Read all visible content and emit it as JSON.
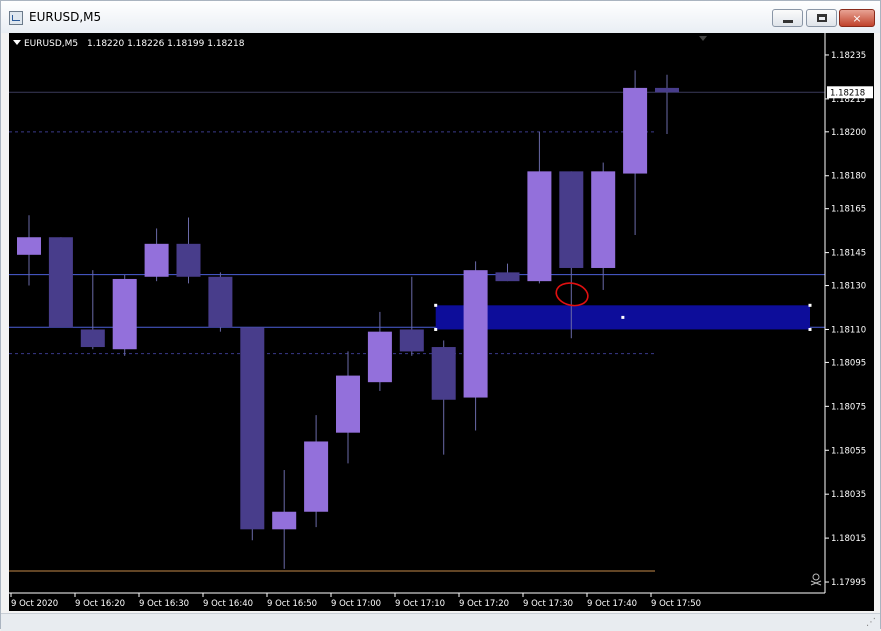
{
  "window": {
    "title": "EURUSD,M5",
    "buttons": {
      "minimize": "minimize",
      "maximize": "maximize",
      "close": "×"
    }
  },
  "colors": {
    "background": "#000000",
    "bull_candle": "#9370db",
    "bear_candle": "#483d8b",
    "wick": "#6a6aa8",
    "hline": "#4c5fd8",
    "dashed_line": "#3a3a8a",
    "rectangle": "#0d0d9a",
    "bottom_line": "#c58a4a",
    "annotation": "#e01010",
    "price_label_bg": "#ffffff",
    "axis_text": "#ffffff"
  },
  "chart_data": {
    "type": "candlestick",
    "symbol": "EURUSD,M5",
    "ohlc_header": "1.18220 1.18226 1.18199 1.18218",
    "current_price": "1.18218",
    "y_range": [
      1.1799,
      1.18245
    ],
    "y_ticks": [
      "1.18235",
      "1.18215",
      "1.18200",
      "1.18180",
      "1.18165",
      "1.18145",
      "1.18130",
      "1.18110",
      "1.18095",
      "1.18075",
      "1.18055",
      "1.18035",
      "1.18015",
      "1.17995"
    ],
    "x_labels": [
      "9 Oct 2020",
      "9 Oct 16:20",
      "9 Oct 16:30",
      "9 Oct 16:40",
      "9 Oct 16:50",
      "9 Oct 17:00",
      "9 Oct 17:10",
      "9 Oct 17:20",
      "9 Oct 17:30",
      "9 Oct 17:40",
      "9 Oct 17:50"
    ],
    "candles": [
      {
        "o": 1.18144,
        "h": 1.18162,
        "l": 1.1813,
        "c": 1.18152
      },
      {
        "o": 1.18152,
        "h": 1.18152,
        "l": 1.18111,
        "c": 1.18111
      },
      {
        "o": 1.1811,
        "h": 1.18137,
        "l": 1.18101,
        "c": 1.18102
      },
      {
        "o": 1.18101,
        "h": 1.18135,
        "l": 1.18098,
        "c": 1.18133
      },
      {
        "o": 1.18134,
        "h": 1.18156,
        "l": 1.18132,
        "c": 1.18149
      },
      {
        "o": 1.18149,
        "h": 1.18161,
        "l": 1.18131,
        "c": 1.18134
      },
      {
        "o": 1.18134,
        "h": 1.18136,
        "l": 1.18109,
        "c": 1.18111
      },
      {
        "o": 1.18111,
        "h": 1.18111,
        "l": 1.18014,
        "c": 1.18019
      },
      {
        "o": 1.18019,
        "h": 1.18046,
        "l": 1.18001,
        "c": 1.18027
      },
      {
        "o": 1.18027,
        "h": 1.18071,
        "l": 1.1802,
        "c": 1.18059
      },
      {
        "o": 1.18063,
        "h": 1.181,
        "l": 1.18049,
        "c": 1.18089
      },
      {
        "o": 1.18086,
        "h": 1.18118,
        "l": 1.18082,
        "c": 1.18109
      },
      {
        "o": 1.1811,
        "h": 1.18134,
        "l": 1.18098,
        "c": 1.181
      },
      {
        "o": 1.18102,
        "h": 1.18105,
        "l": 1.18053,
        "c": 1.18078
      },
      {
        "o": 1.18079,
        "h": 1.18141,
        "l": 1.18064,
        "c": 1.18137
      },
      {
        "o": 1.18136,
        "h": 1.1814,
        "l": 1.18132,
        "c": 1.18132
      },
      {
        "o": 1.18132,
        "h": 1.182,
        "l": 1.18131,
        "c": 1.18182
      },
      {
        "o": 1.18182,
        "h": 1.18182,
        "l": 1.18106,
        "c": 1.18138
      },
      {
        "o": 1.18138,
        "h": 1.18186,
        "l": 1.18128,
        "c": 1.18182
      },
      {
        "o": 1.18181,
        "h": 1.18228,
        "l": 1.18153,
        "c": 1.1822
      },
      {
        "o": 1.1822,
        "h": 1.18226,
        "l": 1.18199,
        "c": 1.18218
      }
    ],
    "hlines": [
      {
        "price": 1.18218,
        "style": "solid",
        "color": "#3a3a5a"
      },
      {
        "price": 1.182,
        "style": "dashed",
        "color": "#3a3a8a"
      },
      {
        "price": 1.18135,
        "style": "solid",
        "color": "#4c5fd8"
      },
      {
        "price": 1.18111,
        "style": "solid",
        "color": "#4c5fd8"
      },
      {
        "price": 1.18099,
        "style": "dashed",
        "color": "#3a3a8a"
      },
      {
        "price": 1.18,
        "style": "solid",
        "color": "#c58a4a"
      }
    ],
    "rectangle": {
      "price_top": 1.18121,
      "price_bottom": 1.1811,
      "start_index": 13,
      "end_index": 25
    },
    "annotation": {
      "type": "ellipse",
      "price": 1.18126,
      "index": 17.4
    }
  }
}
